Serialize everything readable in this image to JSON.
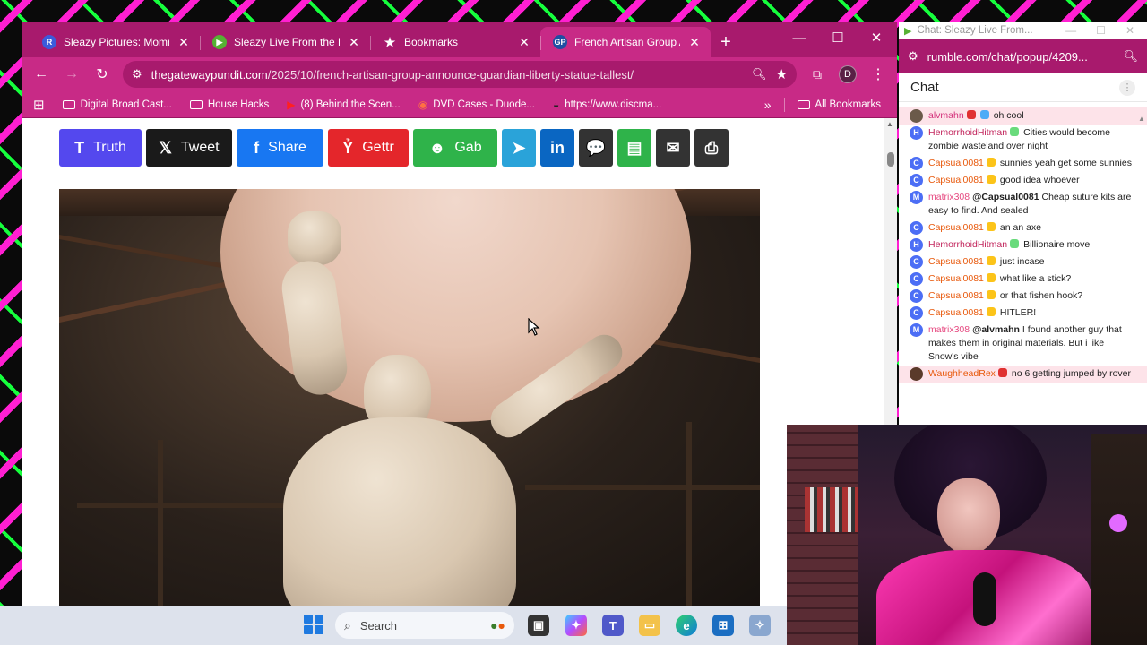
{
  "browser": {
    "tabs": [
      {
        "label": "Sleazy Pictures: Momma",
        "favicon": "R",
        "favicon_color": "#3b5bdb",
        "active": false
      },
      {
        "label": "Sleazy Live From the Bun",
        "favicon": "▶",
        "favicon_color": "#55b233",
        "active": false
      },
      {
        "label": "Bookmarks",
        "favicon": "★",
        "favicon_color": "transparent",
        "active": false
      },
      {
        "label": "French Artisan Group An",
        "favicon": "GP",
        "favicon_color": "#1e4fa3",
        "active": true
      }
    ],
    "address": {
      "domain": "thegatewaypundit.com",
      "path": "/2025/10/french-artisan-group-announce-guardian-liberty-statue-tallest/"
    },
    "profile_letter": "D",
    "bookmarks": [
      {
        "label": "Digital Broad Cast...",
        "icon": "folder-icon"
      },
      {
        "label": "House Hacks",
        "icon": "folder-icon"
      },
      {
        "label": "(8) Behind the Scen...",
        "icon": "youtube-icon"
      },
      {
        "label": "DVD Cases - Duode...",
        "icon": "dvd-icon"
      },
      {
        "label": "https://www.discma...",
        "icon": "disc-icon"
      }
    ],
    "all_bookmarks": "All Bookmarks"
  },
  "share": {
    "buttons": [
      {
        "id": "truth",
        "label": "Truth",
        "color": "#5448ee",
        "icon": "T",
        "width": 92
      },
      {
        "id": "tweet",
        "label": "Tweet",
        "color": "#1a1a1a",
        "icon": "𝕏",
        "width": 96
      },
      {
        "id": "share",
        "label": "Share",
        "color": "#1877f2",
        "icon": "f",
        "width": 97
      },
      {
        "id": "gettr",
        "label": "Gettr",
        "color": "#e4262b",
        "icon": "Ỷ",
        "width": 90
      },
      {
        "id": "gab",
        "label": "Gab",
        "color": "#2fb34a",
        "icon": "☻",
        "width": 94
      },
      {
        "id": "telegram",
        "label": "",
        "color": "#2aa3d9",
        "icon": "➤",
        "width": 38
      },
      {
        "id": "linkedin",
        "label": "",
        "color": "#0a66c2",
        "icon": "in",
        "width": 38
      },
      {
        "id": "comment",
        "label": "",
        "color": "#333333",
        "icon": "💬",
        "width": 38
      },
      {
        "id": "sms",
        "label": "",
        "color": "#2fb34a",
        "icon": "▤",
        "width": 38
      },
      {
        "id": "email",
        "label": "",
        "color": "#333333",
        "icon": "✉",
        "width": 38
      },
      {
        "id": "print",
        "label": "",
        "color": "#333333",
        "icon": "⎙",
        "width": 38
      }
    ]
  },
  "chat": {
    "window_title": "Chat: Sleazy Live From...",
    "url": "rumble.com/chat/popup/4209...",
    "header": "Chat",
    "messages": [
      {
        "user": "alvmahn",
        "avatar": "",
        "avatar_color": "#6b5a4a",
        "user_color": "#d4307a",
        "badges": [
          "#e03131",
          "#4dabf7"
        ],
        "text": "oh cool",
        "highlight": true
      },
      {
        "user": "HemorrhoidHitman",
        "avatar": "H",
        "avatar_color": "#4c6ef5",
        "user_color": "#c2255c",
        "badges": [
          "#69db7c"
        ],
        "text": "Cities would become zombie wasteland over night",
        "highlight": false
      },
      {
        "user": "Capsual0081",
        "avatar": "C",
        "avatar_color": "#4c6ef5",
        "user_color": "#e8590c",
        "badges": [
          "#fcc419"
        ],
        "text": "sunnies yeah get some sunnies",
        "highlight": false
      },
      {
        "user": "Capsual0081",
        "avatar": "C",
        "avatar_color": "#4c6ef5",
        "user_color": "#e8590c",
        "badges": [
          "#fcc419"
        ],
        "text": "good idea whoever",
        "highlight": false
      },
      {
        "user": "matrix308",
        "avatar": "M",
        "avatar_color": "#4c6ef5",
        "user_color": "#e64980",
        "badges": [],
        "mention": "@Capsual0081",
        "text": "Cheap suture kits are easy to find. And sealed",
        "highlight": false
      },
      {
        "user": "Capsual0081",
        "avatar": "C",
        "avatar_color": "#4c6ef5",
        "user_color": "#e8590c",
        "badges": [
          "#fcc419"
        ],
        "text": "an an axe",
        "highlight": false
      },
      {
        "user": "HemorrhoidHitman",
        "avatar": "H",
        "avatar_color": "#4c6ef5",
        "user_color": "#c2255c",
        "badges": [
          "#69db7c"
        ],
        "text": "Billionaire move",
        "highlight": false
      },
      {
        "user": "Capsual0081",
        "avatar": "C",
        "avatar_color": "#4c6ef5",
        "user_color": "#e8590c",
        "badges": [
          "#fcc419"
        ],
        "text": "just incase",
        "highlight": false
      },
      {
        "user": "Capsual0081",
        "avatar": "C",
        "avatar_color": "#4c6ef5",
        "user_color": "#e8590c",
        "badges": [
          "#fcc419"
        ],
        "text": "what like a stick?",
        "highlight": false
      },
      {
        "user": "Capsual0081",
        "avatar": "C",
        "avatar_color": "#4c6ef5",
        "user_color": "#e8590c",
        "badges": [
          "#fcc419"
        ],
        "text": "or that fishen hook?",
        "highlight": false
      },
      {
        "user": "Capsual0081",
        "avatar": "C",
        "avatar_color": "#4c6ef5",
        "user_color": "#e8590c",
        "badges": [
          "#fcc419"
        ],
        "text": "HITLER!",
        "highlight": false
      },
      {
        "user": "matrix308",
        "avatar": "M",
        "avatar_color": "#4c6ef5",
        "user_color": "#e64980",
        "badges": [],
        "mention": "@alvmahn",
        "text": "I found another guy that makes them in original materials. But i like Snow's vibe",
        "highlight": false
      },
      {
        "user": "WaughheadRex",
        "avatar": "",
        "avatar_color": "#5a3a2a",
        "user_color": "#e8590c",
        "badges": [
          "#e03131"
        ],
        "text": "no 6 getting jumped by rover",
        "highlight": true
      }
    ]
  },
  "taskbar": {
    "search_placeholder": "Search"
  }
}
